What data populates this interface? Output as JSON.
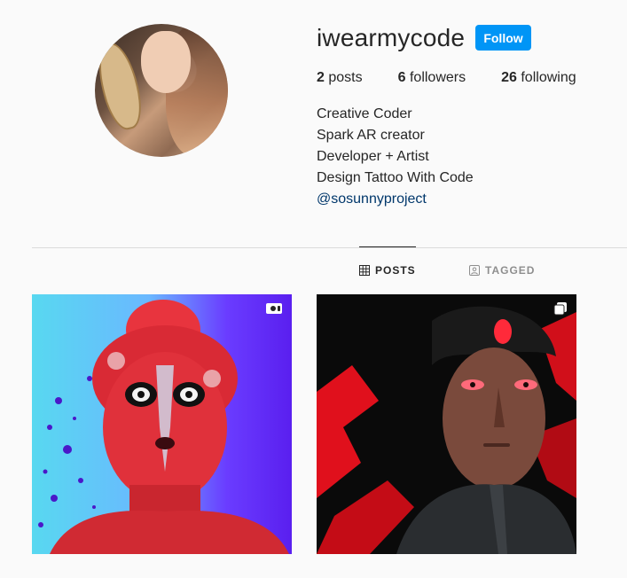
{
  "profile": {
    "username": "iwearmycode",
    "follow_label": "Follow",
    "stats": {
      "posts_count": "2",
      "posts_label": "posts",
      "followers_count": "6",
      "followers_label": "followers",
      "following_count": "26",
      "following_label": "following"
    },
    "bio": {
      "line1": "Creative Coder",
      "line2": "Spark AR creator",
      "line3": "Developer + Artist",
      "line4": "Design Tattoo With Code",
      "mention": "@sosunnyproject"
    }
  },
  "tabs": {
    "posts_label": "POSTS",
    "tagged_label": "TAGGED"
  },
  "posts": [
    {
      "badge_icon": "video-icon"
    },
    {
      "badge_icon": "carousel-icon"
    }
  ],
  "colors": {
    "accent": "#0095f6",
    "link": "#00376b",
    "text": "#262626",
    "muted": "#8e8e8e",
    "background": "#fafafa"
  }
}
